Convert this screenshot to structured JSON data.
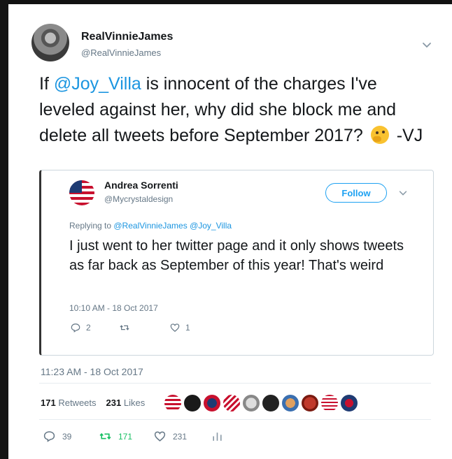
{
  "tweet": {
    "author_name": "RealVinnieJames",
    "author_handle": "@RealVinnieJames",
    "text_before": "If ",
    "mention": "@Joy_Villa",
    "text_after": " is innocent of the charges I've leveled against her, why did she block me and delete all tweets before September 2017? ",
    "signature": " -VJ",
    "timestamp": "11:23 AM - 18 Oct 2017",
    "retweets_count": "171",
    "retweets_label": "Retweets",
    "likes_count": "231",
    "likes_label": "Likes",
    "reply_count": "39",
    "retweet_action_count": "171",
    "like_action_count": "231"
  },
  "quoted_tweet": {
    "author_name": "Andrea Sorrenti",
    "author_handle": "@Mycrystaldesign",
    "follow_label": "Follow",
    "replying_label": "Replying to ",
    "replying_to_1": "@RealVinnieJames",
    "replying_to_2": "@Joy_Villa",
    "text": "I just went to her twitter page and it only shows tweets as far back as September of this year! That's weird",
    "timestamp": "10:10 AM - 18 Oct 2017",
    "reply_count": "2",
    "retweet_count": "",
    "like_count": "1"
  },
  "colors": {
    "link": "#1b95e0",
    "follow": "#1da1f2",
    "retweet_active": "#17bf63",
    "muted": "#657786"
  },
  "likers": [
    "flag-avatar",
    "dark-seal-avatar",
    "flag-avatar",
    "flag-avatar",
    "coin-avatar",
    "cartoon-avatar",
    "red-avatar",
    "sign-avatar",
    "flag-avatar",
    "badge-avatar"
  ]
}
